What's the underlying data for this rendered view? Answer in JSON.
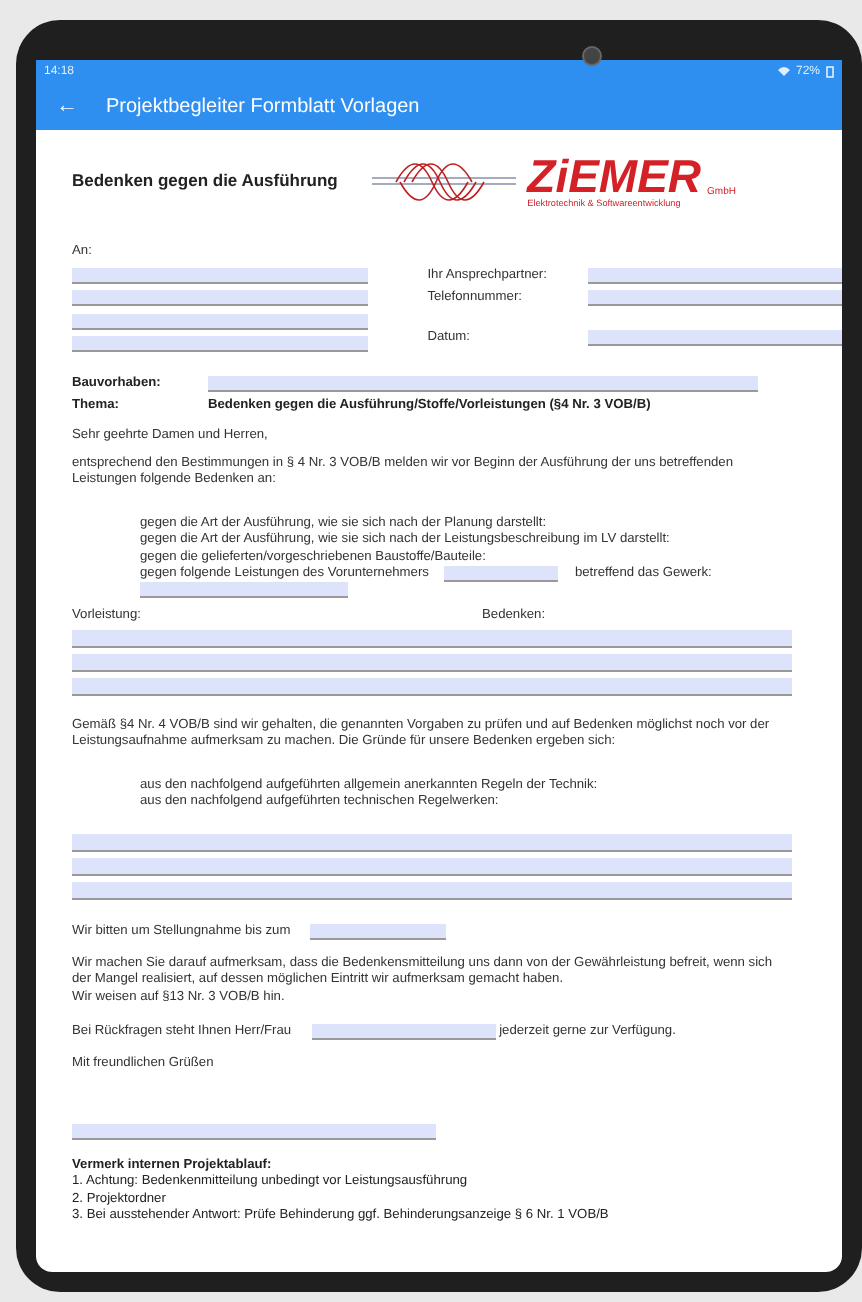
{
  "status_bar": {
    "time": "14:18",
    "battery": "72%"
  },
  "app_bar": {
    "back": "←",
    "title": "Projektbegleiter Formblatt Vorlagen"
  },
  "form": {
    "title": "Bedenken gegen die Ausführung",
    "logo": {
      "name": "ZiEMER",
      "suffix": "GmbH",
      "tagline": "Elektrotechnik & Softwareentwicklung"
    },
    "recipient_label": "An:",
    "contact_labels": [
      "Ihr Ansprechpartner:",
      "Telefonnummer:",
      "Datum:"
    ],
    "project_label": "Bauvorhaben:",
    "topic_label": "Thema:",
    "topic": "Bedenken gegen die Ausführung/Stoffe/Vorleistungen (§4 Nr. 3 VOB/B)",
    "salutation": "Sehr geehrte Damen und Herren,",
    "intro": "entsprechend den Bestimmungen in § 4 Nr. 3 VOB/B melden wir vor Beginn der Ausführung der uns betreffenden Leistungen folgende Bedenken an:",
    "concerns": [
      "gegen die Art der Ausführung, wie sie sich nach der Planung darstellt:",
      "gegen die Art der Ausführung, wie sie sich nach der Leistungsbeschreibung im LV darstellt:",
      "gegen die gelieferten/vorgeschriebenen Baustoffe/Bauteile:"
    ],
    "contractor_line": {
      "before": "gegen folgende Leistungen des Vorunternehmers",
      "after": "betreffend das Gewerk:"
    },
    "column_labels": [
      "Vorleistung:",
      "Bedenken:"
    ],
    "duty": "Gemäß §4 Nr. 4 VOB/B sind wir gehalten, die genannten Vorgaben zu prüfen und auf Bedenken möglichst noch vor der Leistungsaufnahme aufmerksam zu machen. Die Gründe für unsere Bedenken ergeben sich:",
    "reasons": [
      "aus den nachfolgend aufgeführten allgemein anerkannten Regeln der Technik:",
      "aus den nachfolgend aufgeführten technischen Regelwerken:"
    ],
    "deadline": "Wir bitten um Stellungnahme bis zum",
    "notice": [
      "Wir machen Sie darauf aufmerksam, dass die Bedenkensmitteilung uns dann von der Gewährleistung befreit, wenn sich der Mangel realisiert, auf dessen möglichen Eintritt wir aufmerksam gemacht haben.",
      "Wir weisen auf §13 Nr. 3 VOB/B hin."
    ],
    "contact_line": {
      "before": "Bei Rückfragen steht Ihnen Herr/Frau",
      "after": "jederzeit gerne zur Verfügung."
    },
    "closing": "Mit freundlichen Grüßen",
    "internal_note": {
      "title": "Vermerk internen Projektablauf:",
      "items": [
        "1. Achtung: Bedenkenmitteilung unbedingt vor Leistungsausführung",
        "2. Projektordner",
        "3. Bei ausstehender Antwort: Prüfe Behinderung ggf. Behinderungsanzeige § 6 Nr.  1 VOB/B"
      ]
    }
  }
}
